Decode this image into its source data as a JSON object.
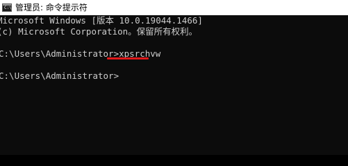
{
  "window": {
    "title": "管理员: 命令提示符",
    "icon": "console-app-icon",
    "icon_glyph": "C:\\"
  },
  "console": {
    "lines": [
      "Microsoft Windows [版本 10.0.19044.1466]",
      "(c) Microsoft Corporation。保留所有权利。",
      "",
      "C:\\Users\\Administrator>",
      "",
      "C:\\Users\\Administrator>"
    ],
    "command": "xpsrchvw"
  },
  "colors": {
    "console_bg": "#0c0c0c",
    "console_text": "#cccccc",
    "highlight_underline": "#e2191b"
  }
}
